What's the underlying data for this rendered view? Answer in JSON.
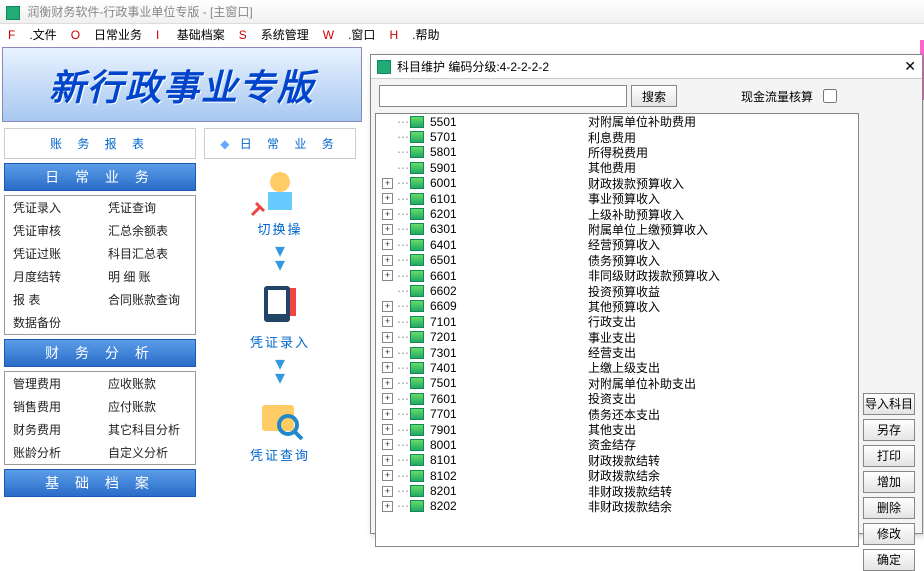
{
  "app": {
    "title": "润衡财务软件-行政事业单位专版 - [主窗口]",
    "banner": "新行政事业专版"
  },
  "menu": [
    {
      "key": "F",
      "label": ".文件"
    },
    {
      "key": "O",
      "label": "日常业务"
    },
    {
      "key": "I",
      "label": " 基础档案"
    },
    {
      "key": "S",
      "label": "系统管理"
    },
    {
      "key": "W",
      "label": ".窗口"
    },
    {
      "key": "H",
      "label": ".帮助"
    }
  ],
  "left": {
    "panel_title": "账 务 报 表",
    "groups": [
      {
        "header": "日 常 业 务",
        "rows": [
          [
            "凭证录入",
            "凭证查询"
          ],
          [
            "凭证审核",
            "汇总余额表"
          ],
          [
            "凭证过账",
            "科目汇总表"
          ],
          [
            "月度结转",
            "明  细  账"
          ],
          [
            "报        表",
            "合同账款查询"
          ],
          [
            "数据备份",
            ""
          ]
        ]
      },
      {
        "header": "财 务 分 析",
        "rows": [
          [
            "管理费用",
            "应收账款"
          ],
          [
            "销售费用",
            "应付账款"
          ],
          [
            "财务费用",
            "其它科目分析"
          ],
          [
            "账龄分析",
            "自定义分析"
          ]
        ]
      },
      {
        "header": "基 础 档 案",
        "rows": []
      }
    ]
  },
  "mid": {
    "panel_title": "日 常 业 务",
    "items": [
      "切换操",
      "凭证录入",
      "凭证查询"
    ]
  },
  "dialog": {
    "title": "科目维护  编码分级:4-2-2-2-2",
    "search_btn": "搜索",
    "cash_label": "现金流量核算",
    "side_buttons": [
      "导入科目",
      "另存",
      "打印",
      "增加",
      "删除",
      "修改",
      "确定"
    ],
    "tree": [
      {
        "exp": "",
        "code": "5501",
        "name": "对附属单位补助费用"
      },
      {
        "exp": "",
        "code": "5701",
        "name": "利息费用"
      },
      {
        "exp": "",
        "code": "5801",
        "name": "所得税费用"
      },
      {
        "exp": "",
        "code": "5901",
        "name": "其他费用"
      },
      {
        "exp": "+",
        "code": "6001",
        "name": "财政拨款预算收入"
      },
      {
        "exp": "+",
        "code": "6101",
        "name": "事业预算收入"
      },
      {
        "exp": "+",
        "code": "6201",
        "name": "上级补助预算收入"
      },
      {
        "exp": "+",
        "code": "6301",
        "name": "附属单位上缴预算收入"
      },
      {
        "exp": "+",
        "code": "6401",
        "name": "经营预算收入"
      },
      {
        "exp": "+",
        "code": "6501",
        "name": "债务预算收入"
      },
      {
        "exp": "+",
        "code": "6601",
        "name": "非同级财政拨款预算收入"
      },
      {
        "exp": "",
        "code": "6602",
        "name": "投资预算收益"
      },
      {
        "exp": "+",
        "code": "6609",
        "name": "其他预算收入"
      },
      {
        "exp": "+",
        "code": "7101",
        "name": "行政支出"
      },
      {
        "exp": "+",
        "code": "7201",
        "name": "事业支出"
      },
      {
        "exp": "+",
        "code": "7301",
        "name": "经营支出"
      },
      {
        "exp": "+",
        "code": "7401",
        "name": "上缴上级支出"
      },
      {
        "exp": "+",
        "code": "7501",
        "name": "对附属单位补助支出"
      },
      {
        "exp": "+",
        "code": "7601",
        "name": "投资支出"
      },
      {
        "exp": "+",
        "code": "7701",
        "name": "债务还本支出"
      },
      {
        "exp": "+",
        "code": "7901",
        "name": "其他支出"
      },
      {
        "exp": "+",
        "code": "8001",
        "name": "资金结存"
      },
      {
        "exp": "+",
        "code": "8101",
        "name": "财政拨款结转"
      },
      {
        "exp": "+",
        "code": "8102",
        "name": "财政拨款结余"
      },
      {
        "exp": "+",
        "code": "8201",
        "name": "非财政拨款结转"
      },
      {
        "exp": "+",
        "code": "8202",
        "name": "非财政拨款结余"
      }
    ]
  }
}
